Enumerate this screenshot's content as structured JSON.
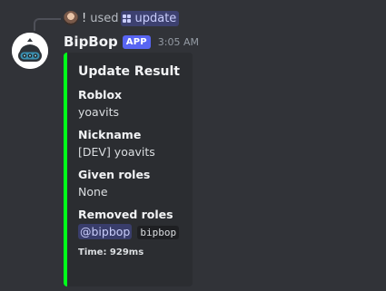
{
  "reply": {
    "user": "!",
    "action": "used",
    "command": "update"
  },
  "message": {
    "author": "BipBop",
    "badge": "APP",
    "timestamp": "3:05 AM"
  },
  "embed": {
    "color": "#00ff1a",
    "title": "Update Result",
    "fields": [
      {
        "name": "Roblox",
        "value": "yoavits"
      },
      {
        "name": "Nickname",
        "value": "[DEV] yoavits"
      },
      {
        "name": "Given roles",
        "value": "None"
      },
      {
        "name": "Removed roles",
        "mention": "@bipbop",
        "code": "bipbop"
      }
    ],
    "footer": "Time: 929ms"
  },
  "icons": {
    "reply_avatar": "user-avatar",
    "command": "slash-command-icon",
    "bot_avatar": "robot-avatar"
  }
}
